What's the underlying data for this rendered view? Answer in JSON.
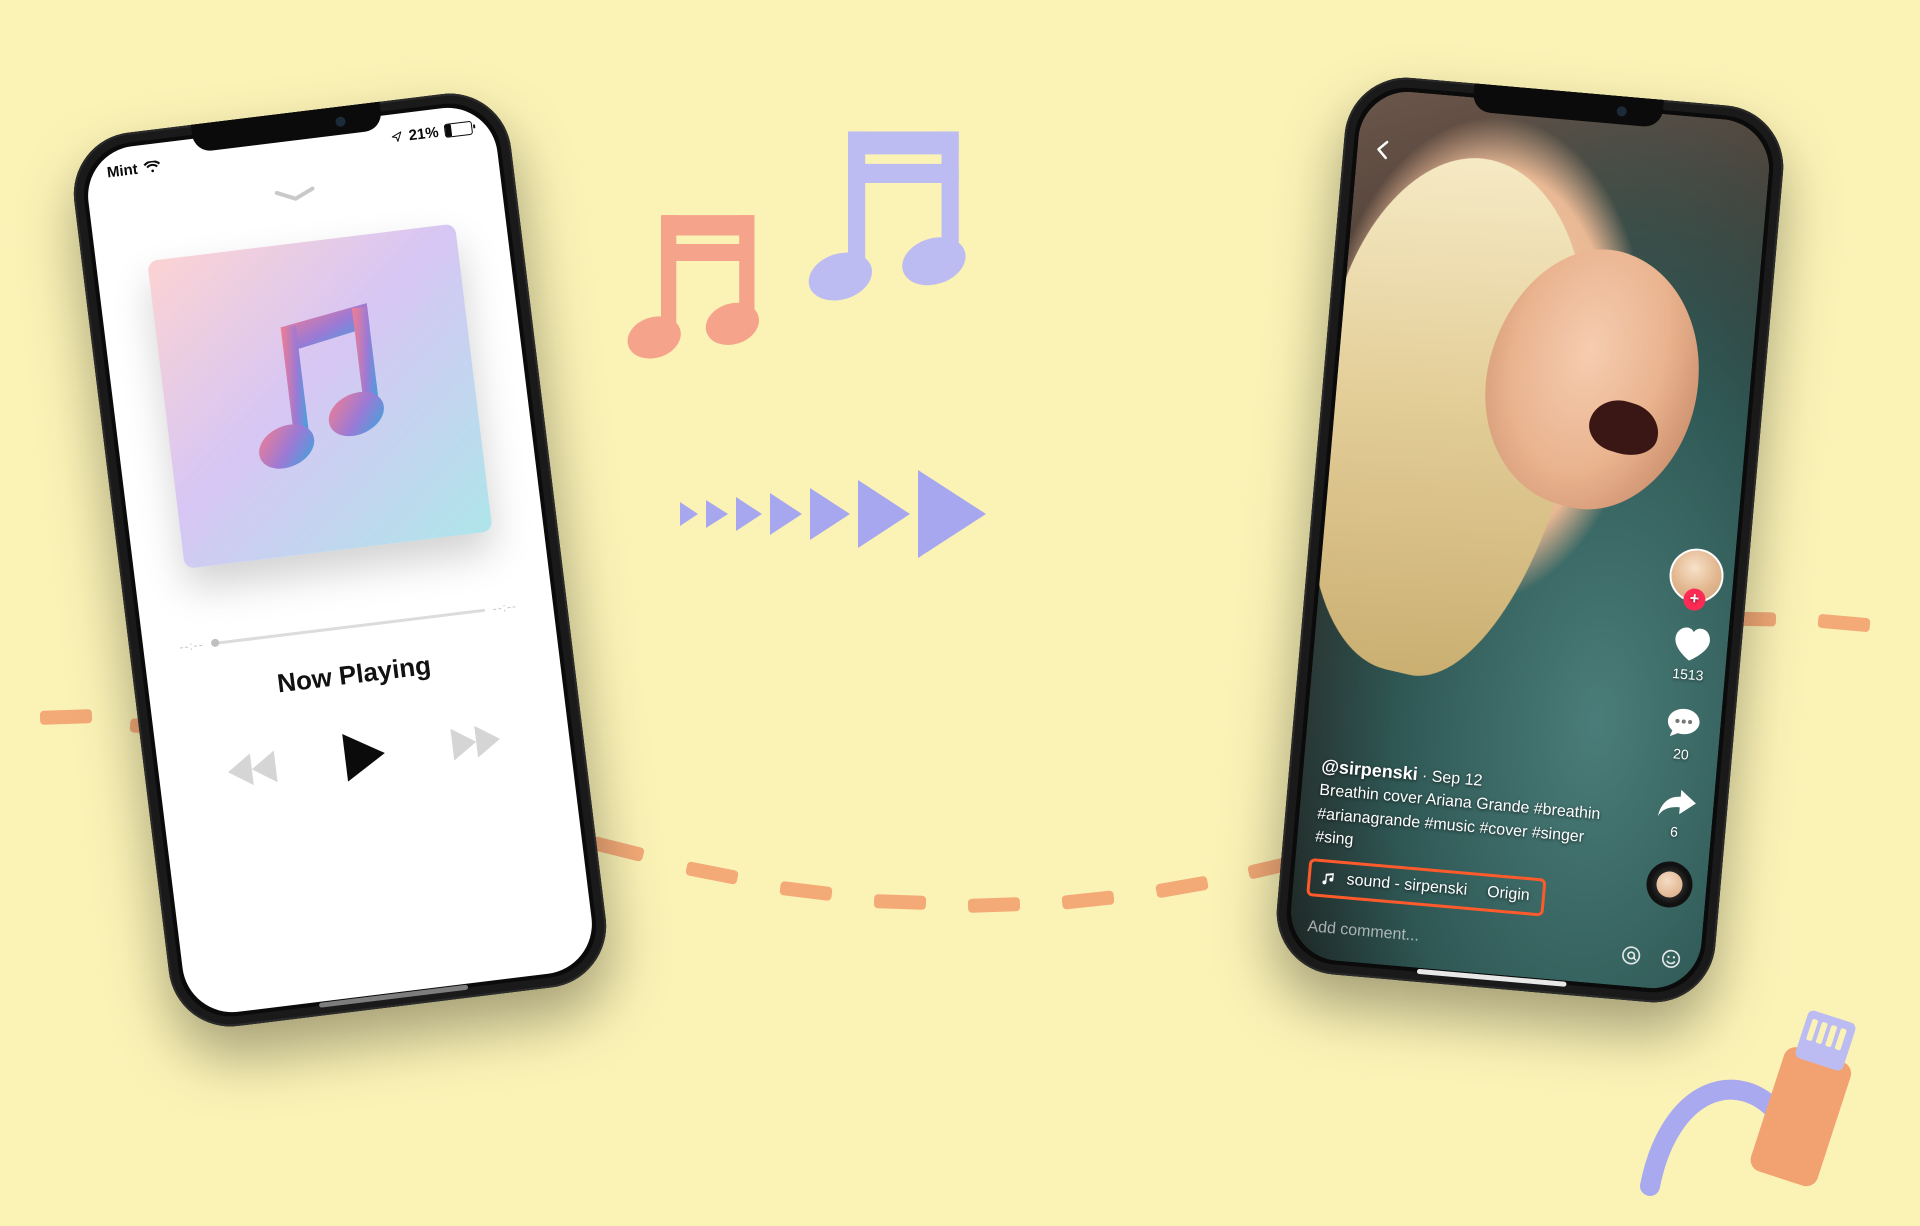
{
  "music_player": {
    "status": {
      "carrier": "Mint",
      "battery_pct": "21%"
    },
    "seek": {
      "elapsed": "--:--",
      "remaining": "--:--"
    },
    "title": "Now Playing"
  },
  "tiktok": {
    "username": "@sirpenski",
    "date": "Sep 12",
    "caption_line1": "Breathin cover Ariana Grande #breathin",
    "caption_line2": "#arianagrande #music #cover #singer",
    "caption_line3": "#sing",
    "sound_text": "sound - sirpenski",
    "sound_suffix": "Origin",
    "like_count": "1513",
    "comment_count": "20",
    "share_count": "6",
    "add_comment_placeholder": "Add comment..."
  }
}
